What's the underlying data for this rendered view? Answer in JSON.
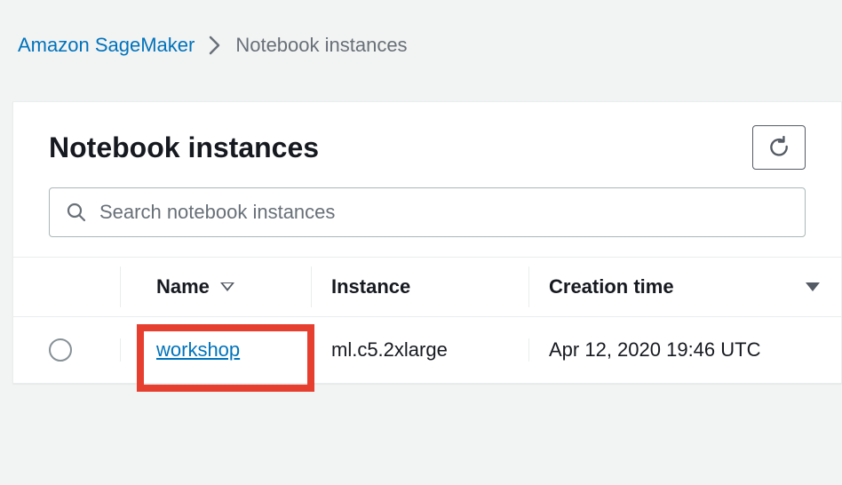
{
  "breadcrumb": {
    "root": "Amazon SageMaker",
    "current": "Notebook instances"
  },
  "panel": {
    "title": "Notebook instances"
  },
  "search": {
    "placeholder": "Search notebook instances"
  },
  "columns": {
    "name": "Name",
    "instance": "Instance",
    "creation_time": "Creation time"
  },
  "rows": [
    {
      "name": "workshop",
      "instance": "ml.c5.2xlarge",
      "creation_time": "Apr 12, 2020 19:46 UTC"
    }
  ]
}
